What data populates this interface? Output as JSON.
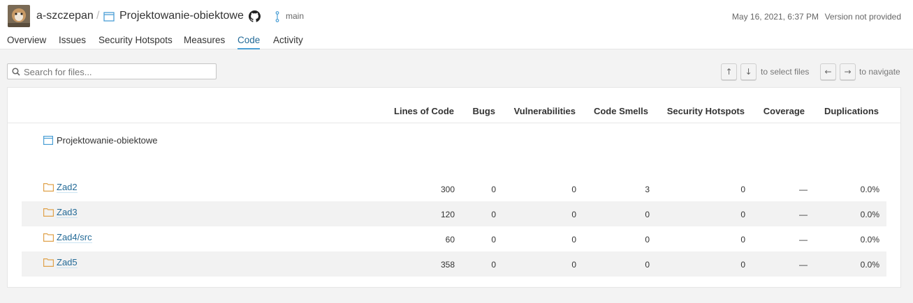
{
  "header": {
    "organization": "a-szczepan",
    "separator": "/",
    "project": "Projektowanie-obiektowe",
    "branch": "main",
    "analysis_date": "May 16, 2021, 6:37 PM",
    "version": "Version not provided"
  },
  "nav": {
    "tabs": [
      {
        "label": "Overview",
        "active": false
      },
      {
        "label": "Issues",
        "active": false
      },
      {
        "label": "Security Hotspots",
        "active": false
      },
      {
        "label": "Measures",
        "active": false
      },
      {
        "label": "Code",
        "active": true
      },
      {
        "label": "Activity",
        "active": false
      }
    ]
  },
  "search": {
    "placeholder": "Search for files...",
    "value": ""
  },
  "shortcuts": {
    "up_key": "↑",
    "down_key": "↓",
    "select_hint": "to select files",
    "left_key": "←",
    "right_key": "→",
    "navigate_hint": "to navigate"
  },
  "table": {
    "columns": [
      "Lines of Code",
      "Bugs",
      "Vulnerabilities",
      "Code Smells",
      "Security Hotspots",
      "Coverage",
      "Duplications"
    ],
    "root": "Projektowanie-obiektowe",
    "rows": [
      {
        "name": "Zad2",
        "loc": "300",
        "bugs": "0",
        "vulnerabilities": "0",
        "code_smells": "3",
        "hotspots": "0",
        "coverage": "—",
        "duplications": "0.0%"
      },
      {
        "name": "Zad3",
        "loc": "120",
        "bugs": "0",
        "vulnerabilities": "0",
        "code_smells": "0",
        "hotspots": "0",
        "coverage": "—",
        "duplications": "0.0%"
      },
      {
        "name": "Zad4/src",
        "loc": "60",
        "bugs": "0",
        "vulnerabilities": "0",
        "code_smells": "0",
        "hotspots": "0",
        "coverage": "—",
        "duplications": "0.0%"
      },
      {
        "name": "Zad5",
        "loc": "358",
        "bugs": "0",
        "vulnerabilities": "0",
        "code_smells": "0",
        "hotspots": "0",
        "coverage": "—",
        "duplications": "0.0%"
      }
    ]
  },
  "colors": {
    "link": "#236a97",
    "active_tab_underline": "#4b9fd5",
    "folder_icon": "#e0a24b",
    "project_icon": "#4b9fd5"
  }
}
